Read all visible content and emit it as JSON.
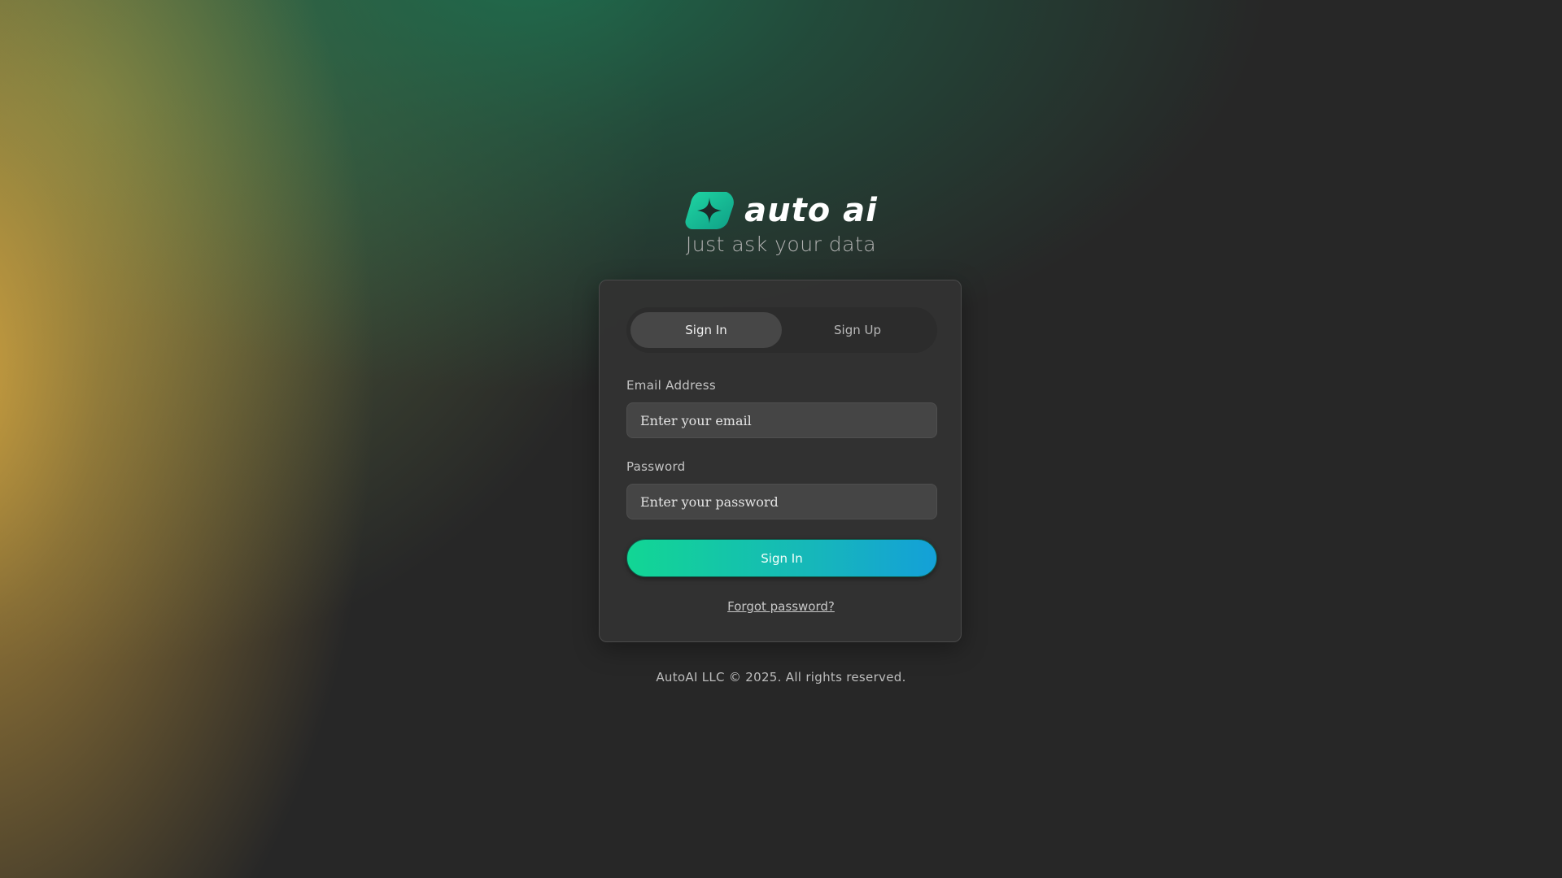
{
  "brand": {
    "logo_text": "auto ai",
    "tagline": "Just ask your data",
    "accent_gradient": [
      "#12d694",
      "#14a0d8"
    ]
  },
  "auth_tabs": [
    {
      "label": "Sign In",
      "active": true
    },
    {
      "label": "Sign Up",
      "active": false
    }
  ],
  "form": {
    "email_label": "Email Address",
    "email_placeholder": "Enter your email",
    "email_value": "",
    "password_label": "Password",
    "password_placeholder": "Enter your password",
    "password_value": "",
    "submit_label": "Sign In",
    "forgot_label": "Forgot password?"
  },
  "footer": {
    "copyright": "AutoAI LLC © 2025. All rights reserved."
  },
  "icons": {
    "logo": "sparkle-icon"
  },
  "colors": {
    "background": "#272727",
    "card": "#323232",
    "input": "#454545"
  }
}
